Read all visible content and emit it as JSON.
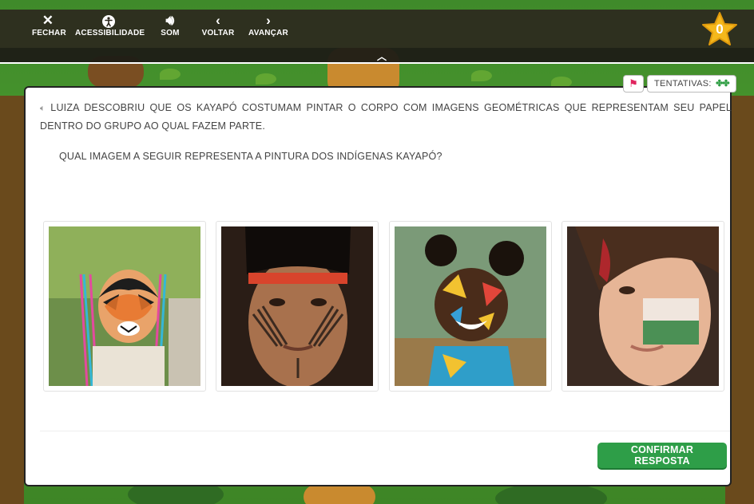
{
  "toolbar": {
    "close_label": "FECHAR",
    "accessibility_label": "ACESSIBILIDADE",
    "sound_label": "SOM",
    "back_label": "VOLTAR",
    "forward_label": "AVANÇAR"
  },
  "score": {
    "value": "0"
  },
  "attempts": {
    "label": "TENTATIVAS:",
    "clovers": "✤✤"
  },
  "question": {
    "text": "LUIZA DESCOBRIU QUE OS KAYAPÓ COSTUMAM PINTAR O CORPO COM IMAGENS GEOMÉTRICAS QUE REPRESENTAM SEU PAPEL DENTRO DO GRUPO AO QUAL FAZEM PARTE.",
    "prompt": "QUAL IMAGEM A SEGUIR REPRESENTA A PINTURA DOS INDÍGENAS KAYAPÓ?"
  },
  "options": [
    {
      "depicts": "child-tiger-face-paint"
    },
    {
      "depicts": "indigenous-geometric-face-paint"
    },
    {
      "depicts": "child-colorful-paint"
    },
    {
      "depicts": "child-flag-face-paint"
    }
  ],
  "actions": {
    "confirm_label": "CONFIRMAR RESPOSTA"
  },
  "colors": {
    "accent_green": "#2e9e48",
    "star_gold": "#f5b81c",
    "toolbar_bg": "#2c281e"
  }
}
